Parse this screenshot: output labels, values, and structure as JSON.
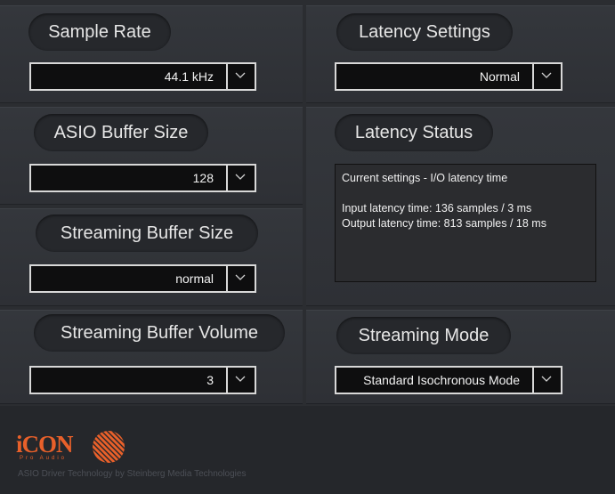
{
  "sample_rate": {
    "title": "Sample Rate",
    "value": "44.1 kHz"
  },
  "latency_settings": {
    "title": "Latency Settings",
    "value": "Normal"
  },
  "asio_buffer": {
    "title": "ASIO Buffer Size",
    "value": "128"
  },
  "latency_status": {
    "title": "Latency Status",
    "line1": "Current settings - I/O latency time",
    "input": "Input latency time: 136 samples / 3 ms",
    "output": "Output latency time: 813 samples / 18 ms"
  },
  "streaming_buffer_size": {
    "title": "Streaming Buffer Size",
    "value": "normal"
  },
  "streaming_buffer_volume": {
    "title": "Streaming Buffer Volume",
    "value": "3"
  },
  "streaming_mode": {
    "title": "Streaming Mode",
    "value": "Standard Isochronous Mode"
  },
  "footer": {
    "logo": "iCON",
    "logo_sub": "Pro Audio",
    "credit": "ASIO Driver Technology by Steinberg Media Technologies"
  },
  "colors": {
    "accent": "#e8602a",
    "background": "#2b2d31"
  },
  "icons": {
    "dropdown": "chevron-down-icon"
  }
}
